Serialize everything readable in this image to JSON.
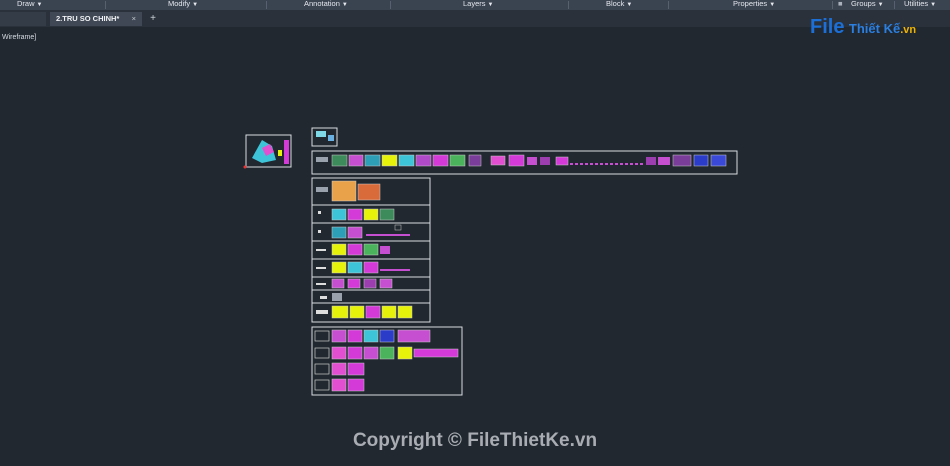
{
  "ribbon": {
    "panels": [
      {
        "label": "Draw"
      },
      {
        "label": "Modify"
      },
      {
        "label": "Annotation"
      },
      {
        "label": "Layers"
      },
      {
        "label": "Block"
      },
      {
        "label": "Properties"
      },
      {
        "label": "Groups"
      },
      {
        "label": "Utilities"
      }
    ]
  },
  "tabs": {
    "active": {
      "label": "2.TRU SO CHINH*",
      "close": "×"
    },
    "add": "+"
  },
  "viewport": {
    "label": "Wireframe]"
  },
  "logo": {
    "first": "File",
    "middle": "Thiết Kế",
    "suffix": ".vn"
  },
  "watermark": "Copyright © FileThietKe.vn",
  "colors": {
    "canvas": "#212830",
    "ribbon": "#3a4350",
    "frame": "#d9dde2",
    "accent_yellow": "#e6f20a",
    "accent_magenta": "#d43ad8"
  }
}
